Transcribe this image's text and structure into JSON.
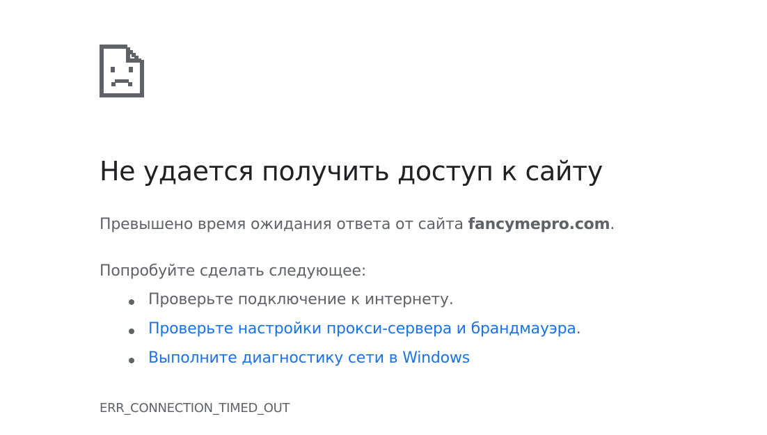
{
  "icon": "sad-page-icon",
  "heading": "Не удается получить доступ к сайту",
  "summary": {
    "prefix": "Превышено время ожидания ответа от сайта ",
    "host": "fancymepro.com",
    "suffix": "."
  },
  "suggestions": {
    "title": "Попробуйте сделать следующее:",
    "items": [
      {
        "text": "Проверьте подключение к интернету.",
        "link": false
      },
      {
        "text": "Проверьте настройки прокси-сервера и брандмауэра",
        "suffix": ".",
        "link": true
      },
      {
        "text": "Выполните диагностику сети в Windows",
        "link": true
      }
    ]
  },
  "error_code": "ERR_CONNECTION_TIMED_OUT",
  "colors": {
    "heading": "#202124",
    "body_text": "#5f6368",
    "link": "#1a73e8",
    "icon": "#5f6368"
  }
}
